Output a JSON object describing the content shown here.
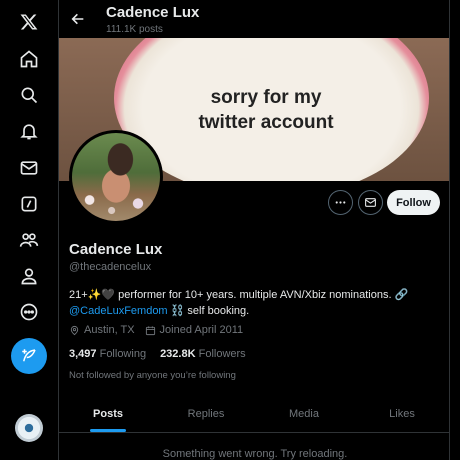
{
  "nav": {
    "items": [
      {
        "icon": "x-logo-icon"
      },
      {
        "icon": "home-icon"
      },
      {
        "icon": "search-icon"
      },
      {
        "icon": "notifications-bell-icon"
      },
      {
        "icon": "messages-envelope-icon"
      },
      {
        "icon": "grok-slash-icon"
      },
      {
        "icon": "communities-icon"
      },
      {
        "icon": "profile-person-icon"
      },
      {
        "icon": "more-circle-icon"
      }
    ],
    "compose_icon": "compose-feather-icon",
    "accent": "#1d9bf0"
  },
  "header": {
    "name": "Cadence Lux",
    "posts": "111.1K posts"
  },
  "banner": {
    "line1": "sorry for my",
    "line2": "twitter account"
  },
  "profile": {
    "name": "Cadence Lux",
    "handle": "@thecadencelux",
    "bio_text": "21+✨🖤 performer for 10+ years. multiple AVN/Xbiz nominations. 🔗",
    "bio_link": "@CadeLuxFemdom",
    "bio_end": " ⛓️ self booking.",
    "location": "Austin, TX",
    "joined": "Joined April 2011",
    "following_count": "3,497",
    "following_label": "Following",
    "followers_count": "232.8K",
    "followers_label": "Followers",
    "not_followed": "Not followed by anyone you’re following"
  },
  "actions": {
    "more_icon": "more-dots-icon",
    "message_icon": "message-envelope-icon",
    "follow_label": "Follow"
  },
  "tabs": [
    {
      "label": "Posts",
      "active": true
    },
    {
      "label": "Replies",
      "active": false
    },
    {
      "label": "Media",
      "active": false
    },
    {
      "label": "Likes",
      "active": false
    }
  ],
  "error_message": "Something went wrong. Try reloading."
}
